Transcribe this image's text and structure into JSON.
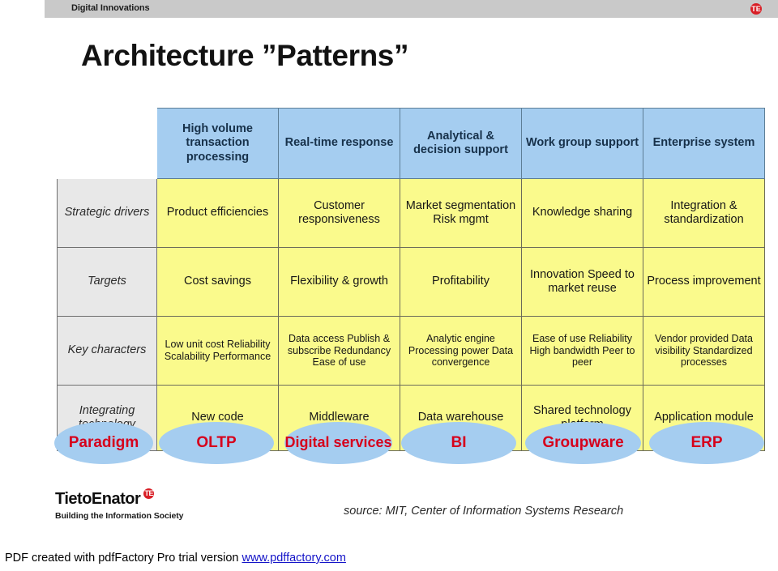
{
  "header": {
    "band_title": "Digital Innovations",
    "logo_mark": "TE",
    "band_color": "#c9c9c9",
    "logo_color": "#d81f26"
  },
  "title": "Architecture ”Patterns”",
  "matrix": {
    "header_color": "#a5cdf0",
    "cell_color": "#fafa8c",
    "label_color": "#e8e8e8",
    "columns": [
      "High volume transaction processing",
      "Real-time response",
      "Analytical & decision support",
      "Work group support",
      "Enterprise system"
    ],
    "rows": [
      {
        "label": "Strategic drivers",
        "cells": [
          "Product efficiencies",
          "Customer responsiveness",
          "Market segmentation Risk mgmt",
          "Knowledge sharing",
          "Integration & standardization"
        ]
      },
      {
        "label": "Targets",
        "cells": [
          "Cost savings",
          "Flexibility & growth",
          "Profitability",
          "Innovation Speed to market reuse",
          "Process improvement"
        ]
      },
      {
        "label": "Key characters",
        "cells": [
          "Low unit cost Reliability Scalability Performance",
          "Data access Publish & subscribe Redundancy Ease of use",
          "Analytic engine Processing power Data convergence",
          "Ease of use Reliability High bandwidth Peer to peer",
          "Vendor provided Data visibility Standardized processes"
        ]
      },
      {
        "label": "Integrating technology",
        "cells": [
          "New code",
          "Middleware",
          "Data warehouse",
          "Shared technology platform",
          "Application module"
        ]
      }
    ]
  },
  "paradigm": {
    "text_color": "#d6001c",
    "pill_color": "#a5cdf0",
    "items": [
      "Paradigm",
      "OLTP",
      "Digital services",
      "BI",
      "Groupware",
      "ERP"
    ]
  },
  "footer": {
    "brand": "TietoEnator",
    "brand_mark": "TE",
    "tagline": "Building the Information Society",
    "source": "source: MIT, Center of Information Systems Research"
  },
  "watermark": {
    "text": "PDF created with pdfFactory Pro trial version ",
    "link": "www.pdffactory.com",
    "link_color": "#1414c8"
  }
}
